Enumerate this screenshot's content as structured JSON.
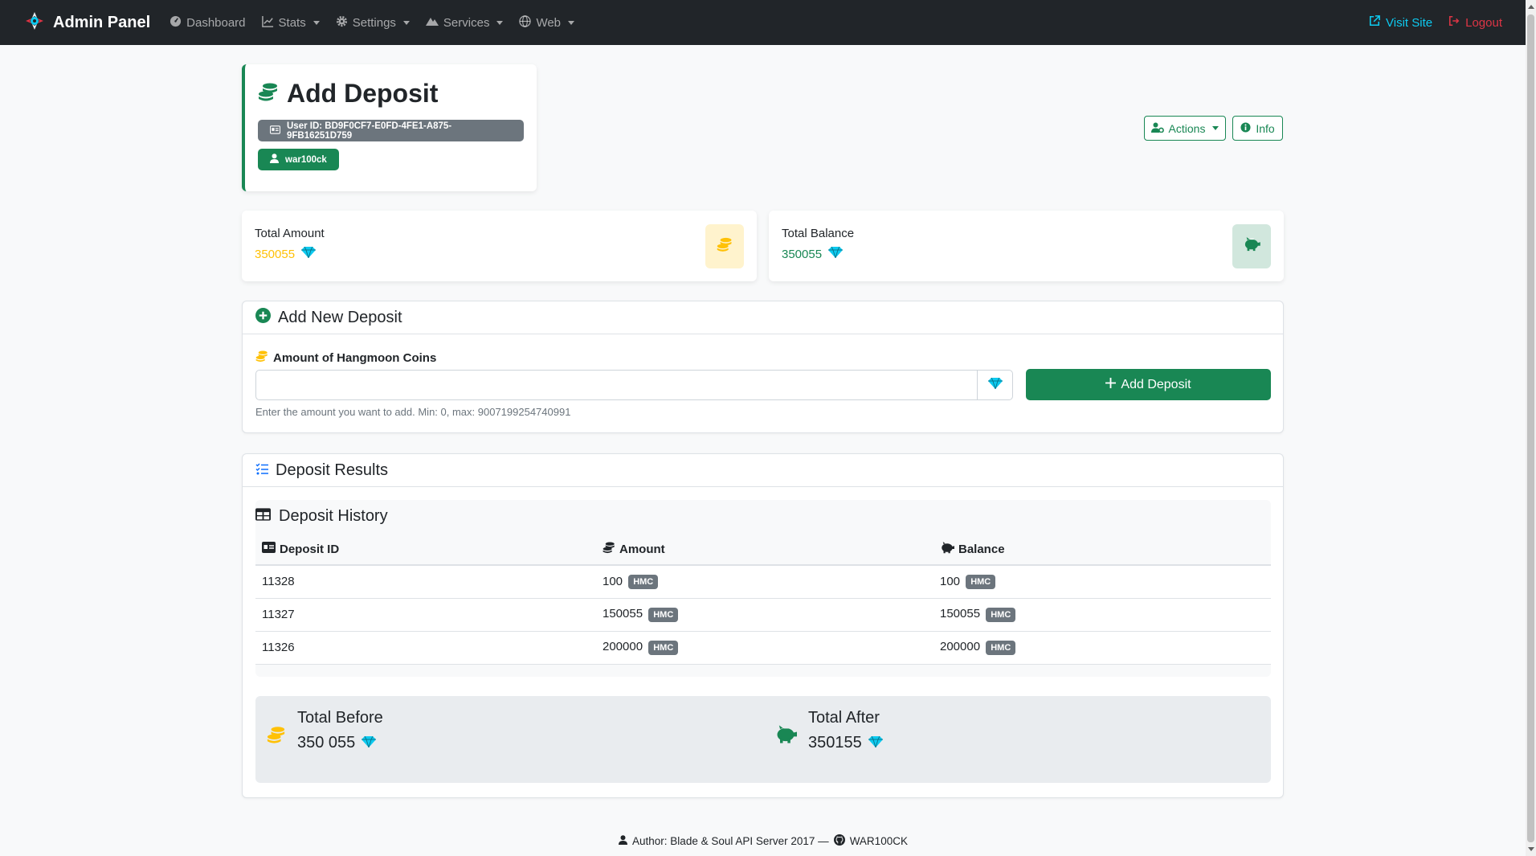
{
  "nav": {
    "brand": "Admin Panel",
    "items": [
      "Dashboard",
      "Stats",
      "Settings",
      "Services",
      "Web"
    ],
    "visit_site": "Visit Site",
    "logout": "Logout"
  },
  "header": {
    "title": "Add Deposit",
    "user_id": "User ID: BD9F0CF7-E0FD-4FE1-A875-9FB16251D759",
    "username": "war100ck",
    "actions_label": "Actions",
    "info_label": "Info"
  },
  "stats": {
    "total_amount_label": "Total Amount",
    "total_amount_value": "350055",
    "total_balance_label": "Total Balance",
    "total_balance_value": "350055"
  },
  "add_form": {
    "card_title": "Add New Deposit",
    "field_label": "Amount of Hangmoon Coins",
    "input_value": "",
    "input_placeholder": "",
    "button_label": "Add Deposit",
    "help_text": "Enter the amount you want to add. Min: 0, max: 9007199254740991"
  },
  "results": {
    "card_title": "Deposit Results",
    "history_title": "Deposit History",
    "columns": [
      "Deposit ID",
      "Amount",
      "Balance"
    ],
    "currency": "HMC",
    "rows": [
      {
        "id": "11328",
        "amount": "100",
        "balance": "100"
      },
      {
        "id": "11327",
        "amount": "150055",
        "balance": "150055"
      },
      {
        "id": "11326",
        "amount": "200000",
        "balance": "200000"
      }
    ],
    "total_before_label": "Total Before",
    "total_before_value": "350 055",
    "total_after_label": "Total After",
    "total_after_value": "350155"
  },
  "footer": {
    "author": "Author: Blade & Soul API Server 2017 —",
    "github": "WAR100CK"
  },
  "colors": {
    "accent": "#198754",
    "gold": "#ffc107",
    "diamond": "#0dcaf0",
    "navbar": "#212529",
    "danger": "#dc3545"
  }
}
